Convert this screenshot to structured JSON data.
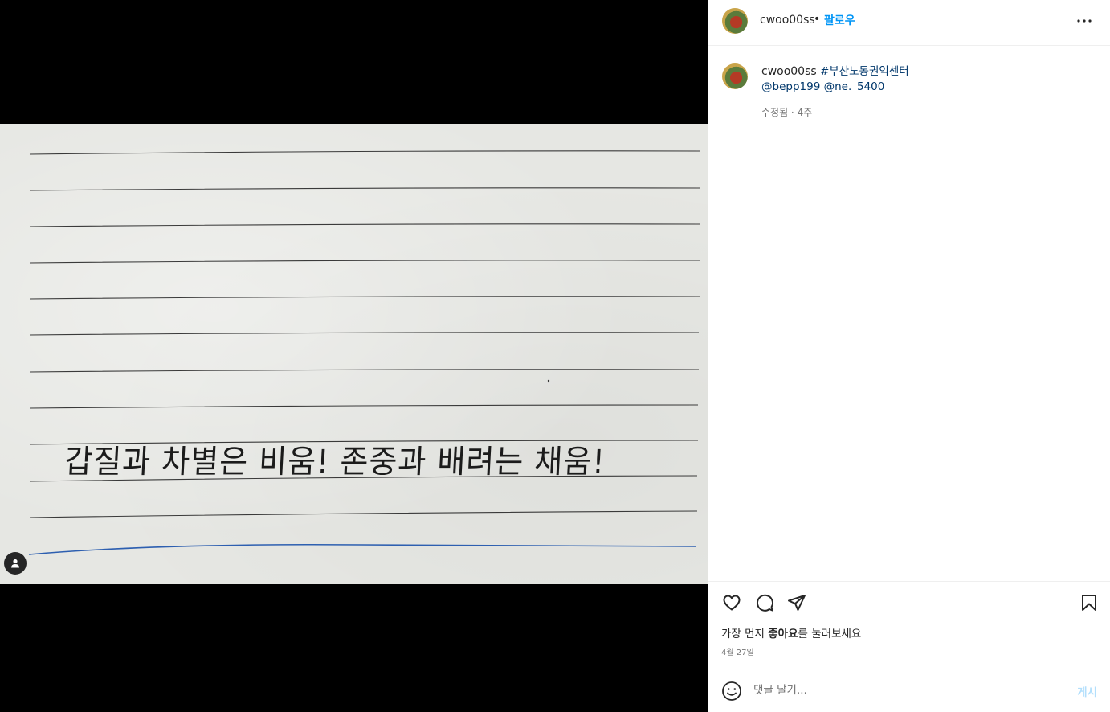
{
  "post": {
    "photo": {
      "handwritten_text": "갑질과 차별은 비움! 존중과 배려는 채움!"
    }
  },
  "header": {
    "username": "cwoo00ss",
    "separator": "•",
    "follow_label": "팔로우"
  },
  "caption": {
    "username": "cwoo00ss",
    "hashtag": "#부산노동권익센터",
    "mention_1": "@bepp199",
    "mention_2": "@ne._5400",
    "meta": "수정됨 · 4주"
  },
  "likes": {
    "prefix": "가장 먼저 ",
    "bold": "좋아요",
    "suffix": "를 눌러보세요"
  },
  "date": "4월 27일",
  "comment": {
    "placeholder": "댓글 달기...",
    "post_label": "게시"
  },
  "colors": {
    "accent": "#0095f6",
    "link": "#00376b",
    "post_disabled": "#b2dffc"
  }
}
